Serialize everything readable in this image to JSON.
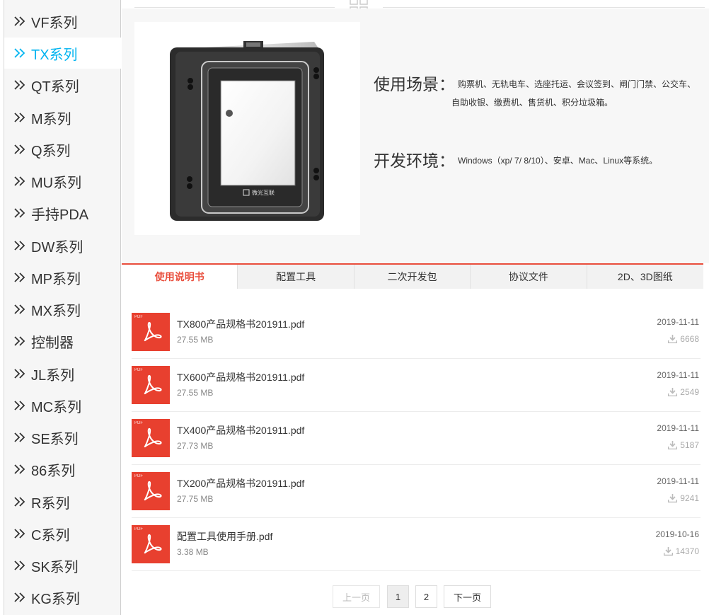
{
  "sidebar": {
    "items": [
      {
        "label": "VF系列",
        "active": false
      },
      {
        "label": "TX系列",
        "active": true
      },
      {
        "label": "QT系列",
        "active": false
      },
      {
        "label": "M系列",
        "active": false
      },
      {
        "label": "Q系列",
        "active": false
      },
      {
        "label": "MU系列",
        "active": false
      },
      {
        "label": "手持PDA",
        "active": false
      },
      {
        "label": "DW系列",
        "active": false
      },
      {
        "label": "MP系列",
        "active": false
      },
      {
        "label": "MX系列",
        "active": false
      },
      {
        "label": "控制器",
        "active": false
      },
      {
        "label": "JL系列",
        "active": false
      },
      {
        "label": "MC系列",
        "active": false
      },
      {
        "label": "SE系列",
        "active": false
      },
      {
        "label": "86系列",
        "active": false
      },
      {
        "label": "R系列",
        "active": false
      },
      {
        "label": "C系列",
        "active": false
      },
      {
        "label": "SK系列",
        "active": false
      },
      {
        "label": "KG系列",
        "active": false
      }
    ]
  },
  "product": {
    "brand_on_device": "微光互联",
    "scenario_label": "使用场景：",
    "scenario_line1": "购票机、无轨电车、选座托运、会议签到、闸门门禁、公交车、",
    "scenario_line2": "自助收银、缴费机、售货机、积分垃圾箱。",
    "env_label": "开发环境：",
    "env_text": "Windows（xp/ 7/ 8/10）、安卓、Mac、Linux等系统。"
  },
  "tabs": [
    {
      "label": "使用说明书",
      "active": true
    },
    {
      "label": "配置工具",
      "active": false
    },
    {
      "label": "二次开发包",
      "active": false
    },
    {
      "label": "协议文件",
      "active": false
    },
    {
      "label": "2D、3D图纸",
      "active": false
    }
  ],
  "files": [
    {
      "name": "TX800产品规格书201911.pdf",
      "size": "27.55 MB",
      "date": "2019-11-11",
      "downloads": "6668"
    },
    {
      "name": "TX600产品规格书201911.pdf",
      "size": "27.55 MB",
      "date": "2019-11-11",
      "downloads": "2549"
    },
    {
      "name": "TX400产品规格书201911.pdf",
      "size": "27.73 MB",
      "date": "2019-11-11",
      "downloads": "5187"
    },
    {
      "name": "TX200产品规格书201911.pdf",
      "size": "27.75 MB",
      "date": "2019-11-11",
      "downloads": "9241"
    },
    {
      "name": "配置工具使用手册.pdf",
      "size": "3.38 MB",
      "date": "2019-10-16",
      "downloads": "14370"
    }
  ],
  "file_icon_tag": "PDF",
  "pagination": {
    "prev": "上一页",
    "pages": [
      "1",
      "2"
    ],
    "current": "1",
    "next": "下一页"
  },
  "colors": {
    "accent_red": "#e94e3c",
    "active_sidebar": "#00b4f0",
    "pdf_icon": "#e8402f"
  }
}
